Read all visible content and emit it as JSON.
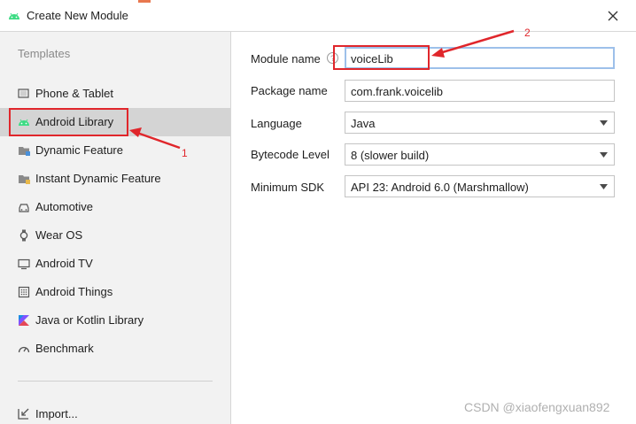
{
  "dialog": {
    "title": "Create New Module"
  },
  "sidebar": {
    "heading": "Templates",
    "items": [
      {
        "label": "Phone & Tablet",
        "icon": "phone-tablet-icon",
        "selected": false
      },
      {
        "label": "Android Library",
        "icon": "android-icon",
        "selected": true
      },
      {
        "label": "Dynamic Feature",
        "icon": "dynamic-feature-icon",
        "selected": false
      },
      {
        "label": "Instant Dynamic Feature",
        "icon": "instant-dynamic-feature-icon",
        "selected": false
      },
      {
        "label": "Automotive",
        "icon": "car-icon",
        "selected": false
      },
      {
        "label": "Wear OS",
        "icon": "watch-icon",
        "selected": false
      },
      {
        "label": "Android TV",
        "icon": "tv-icon",
        "selected": false
      },
      {
        "label": "Android Things",
        "icon": "things-board-icon",
        "selected": false
      },
      {
        "label": "Java or Kotlin Library",
        "icon": "kotlin-icon",
        "selected": false
      },
      {
        "label": "Benchmark",
        "icon": "gauge-icon",
        "selected": false
      }
    ],
    "import_label": "Import..."
  },
  "form": {
    "module_name": {
      "label": "Module name",
      "value": "voiceLib"
    },
    "package_name": {
      "label": "Package name",
      "value": "com.frank.voicelib"
    },
    "language": {
      "label": "Language",
      "value": "Java"
    },
    "bytecode_level": {
      "label": "Bytecode Level",
      "value": "8 (slower build)"
    },
    "minimum_sdk": {
      "label": "Minimum SDK",
      "value": "API 23: Android 6.0 (Marshmallow)"
    }
  },
  "annotations": {
    "marker_1": "1",
    "marker_2": "2",
    "color": "#e0262b"
  },
  "watermark": "CSDN @xiaofengxuan892",
  "colors": {
    "selected_bg": "#d4d4d4",
    "sidebar_bg": "#f2f2f2",
    "android_green": "#3ddc84",
    "focus_border": "#9dc0ea"
  }
}
